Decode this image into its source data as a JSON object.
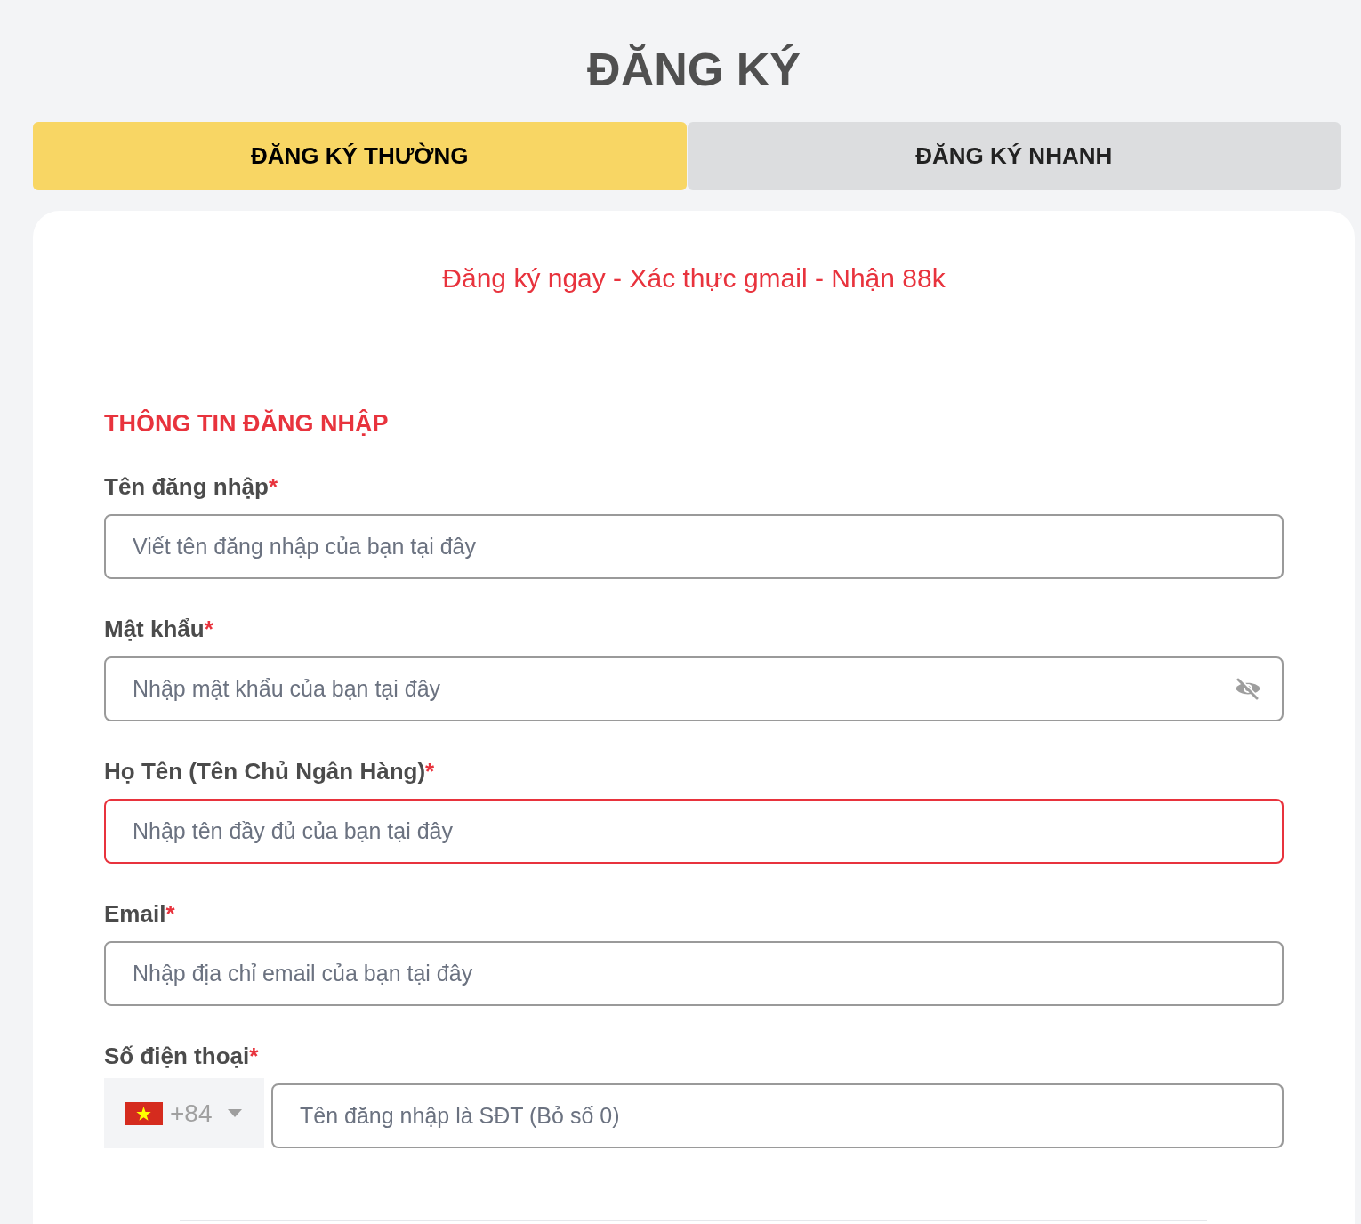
{
  "page_title": "ĐĂNG KÝ",
  "tabs": [
    {
      "label": "ĐĂNG KÝ THƯỜNG",
      "selected": true
    },
    {
      "label": "ĐĂNG KÝ NHANH",
      "selected": false
    }
  ],
  "form": {
    "promo": "Đăng ký ngay - Xác thực gmail - Nhận 88k",
    "section_title": "THÔNG TIN ĐĂNG NHẬP",
    "fields": [
      {
        "kind": "text",
        "label": "Tên đăng nhập",
        "required_mark": "*",
        "placeholder": "Viết tên đăng nhập của bạn tại đây",
        "error": false
      },
      {
        "kind": "password",
        "label": "Mật khẩu",
        "required_mark": "*",
        "placeholder": "Nhập mật khẩu của bạn tại đây",
        "error": false
      },
      {
        "kind": "text",
        "label": "Họ Tên (Tên Chủ Ngân Hàng)",
        "required_mark": "*",
        "placeholder": "Nhập tên đầy đủ của bạn tại đây",
        "error": true
      },
      {
        "kind": "text",
        "label": "Email",
        "required_mark": "*",
        "placeholder": "Nhập địa chỉ email của bạn tại đây",
        "error": false
      },
      {
        "kind": "phone",
        "label": "Số điện thoại",
        "required_mark": "*",
        "country_code": "+84",
        "placeholder": "Tên đăng nhập là SĐT (Bỏ số 0)",
        "error": false
      }
    ]
  }
}
